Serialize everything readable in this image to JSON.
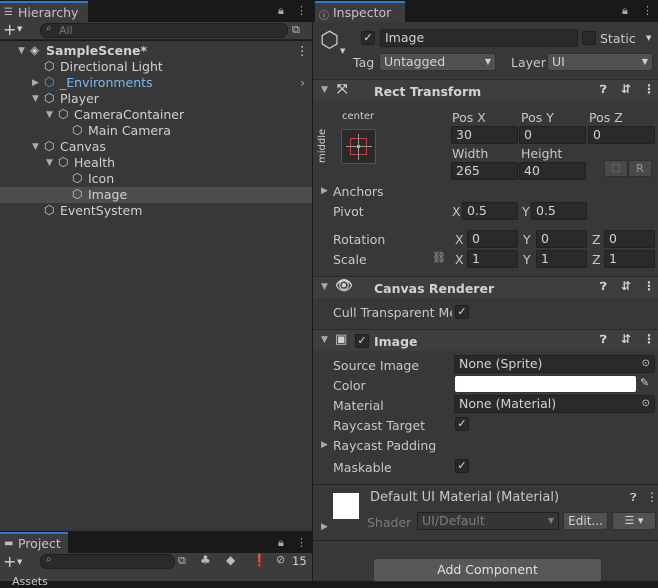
{
  "hierarchy": {
    "tab": "Hierarchy",
    "search_placeholder": "All",
    "add": "+",
    "items": [
      {
        "label": "SampleScene*",
        "depth": 0,
        "expanded": true,
        "kind": "scene"
      },
      {
        "label": "Directional Light",
        "depth": 1
      },
      {
        "label": "_Environments",
        "depth": 1,
        "collapsed": true,
        "prefab": true
      },
      {
        "label": "Player",
        "depth": 1,
        "expanded": true
      },
      {
        "label": "CameraContainer",
        "depth": 2,
        "expanded": true
      },
      {
        "label": "Main Camera",
        "depth": 3
      },
      {
        "label": "Canvas",
        "depth": 1,
        "expanded": true
      },
      {
        "label": "Health",
        "depth": 2,
        "expanded": true
      },
      {
        "label": "Icon",
        "depth": 3
      },
      {
        "label": "Image",
        "depth": 3,
        "selected": true
      },
      {
        "label": "EventSystem",
        "depth": 1
      }
    ]
  },
  "project": {
    "tab": "Project",
    "hidden_count": "15",
    "partial_text": "Assets"
  },
  "inspector": {
    "tab": "Inspector",
    "name": "Image",
    "static_label": "Static",
    "tag_label": "Tag",
    "tag_value": "Untagged",
    "layer_label": "Layer",
    "layer_value": "UI",
    "rect": {
      "title": "Rect Transform",
      "anchor_h": "center",
      "anchor_v": "middle",
      "posx_label": "Pos X",
      "posy_label": "Pos Y",
      "posz_label": "Pos Z",
      "posx": "30",
      "posy": "0",
      "posz": "0",
      "width_label": "Width",
      "height_label": "Height",
      "width": "265",
      "height": "40",
      "r_btn": "R",
      "anchors": "Anchors",
      "pivot": "Pivot",
      "pivot_x": "0.5",
      "pivot_y": "0.5",
      "rotation": "Rotation",
      "rot_x": "0",
      "rot_y": "0",
      "rot_z": "0",
      "scale": "Scale",
      "scale_x": "1",
      "scale_y": "1",
      "scale_z": "1",
      "x": "X",
      "y": "Y",
      "z": "Z"
    },
    "canvas_renderer": {
      "title": "Canvas Renderer",
      "cull": "Cull Transparent Mes"
    },
    "image": {
      "title": "Image",
      "source_label": "Source Image",
      "source_value": "None (Sprite)",
      "color_label": "Color",
      "color_value": "#ffffff",
      "material_label": "Material",
      "material_value": "None (Material)",
      "raycast_target": "Raycast Target",
      "raycast_padding": "Raycast Padding",
      "maskable": "Maskable"
    },
    "material": {
      "title": "Default UI Material (Material)",
      "shader_label": "Shader",
      "shader_value": "UI/Default",
      "edit": "Edit..."
    },
    "add_component": "Add Component"
  }
}
